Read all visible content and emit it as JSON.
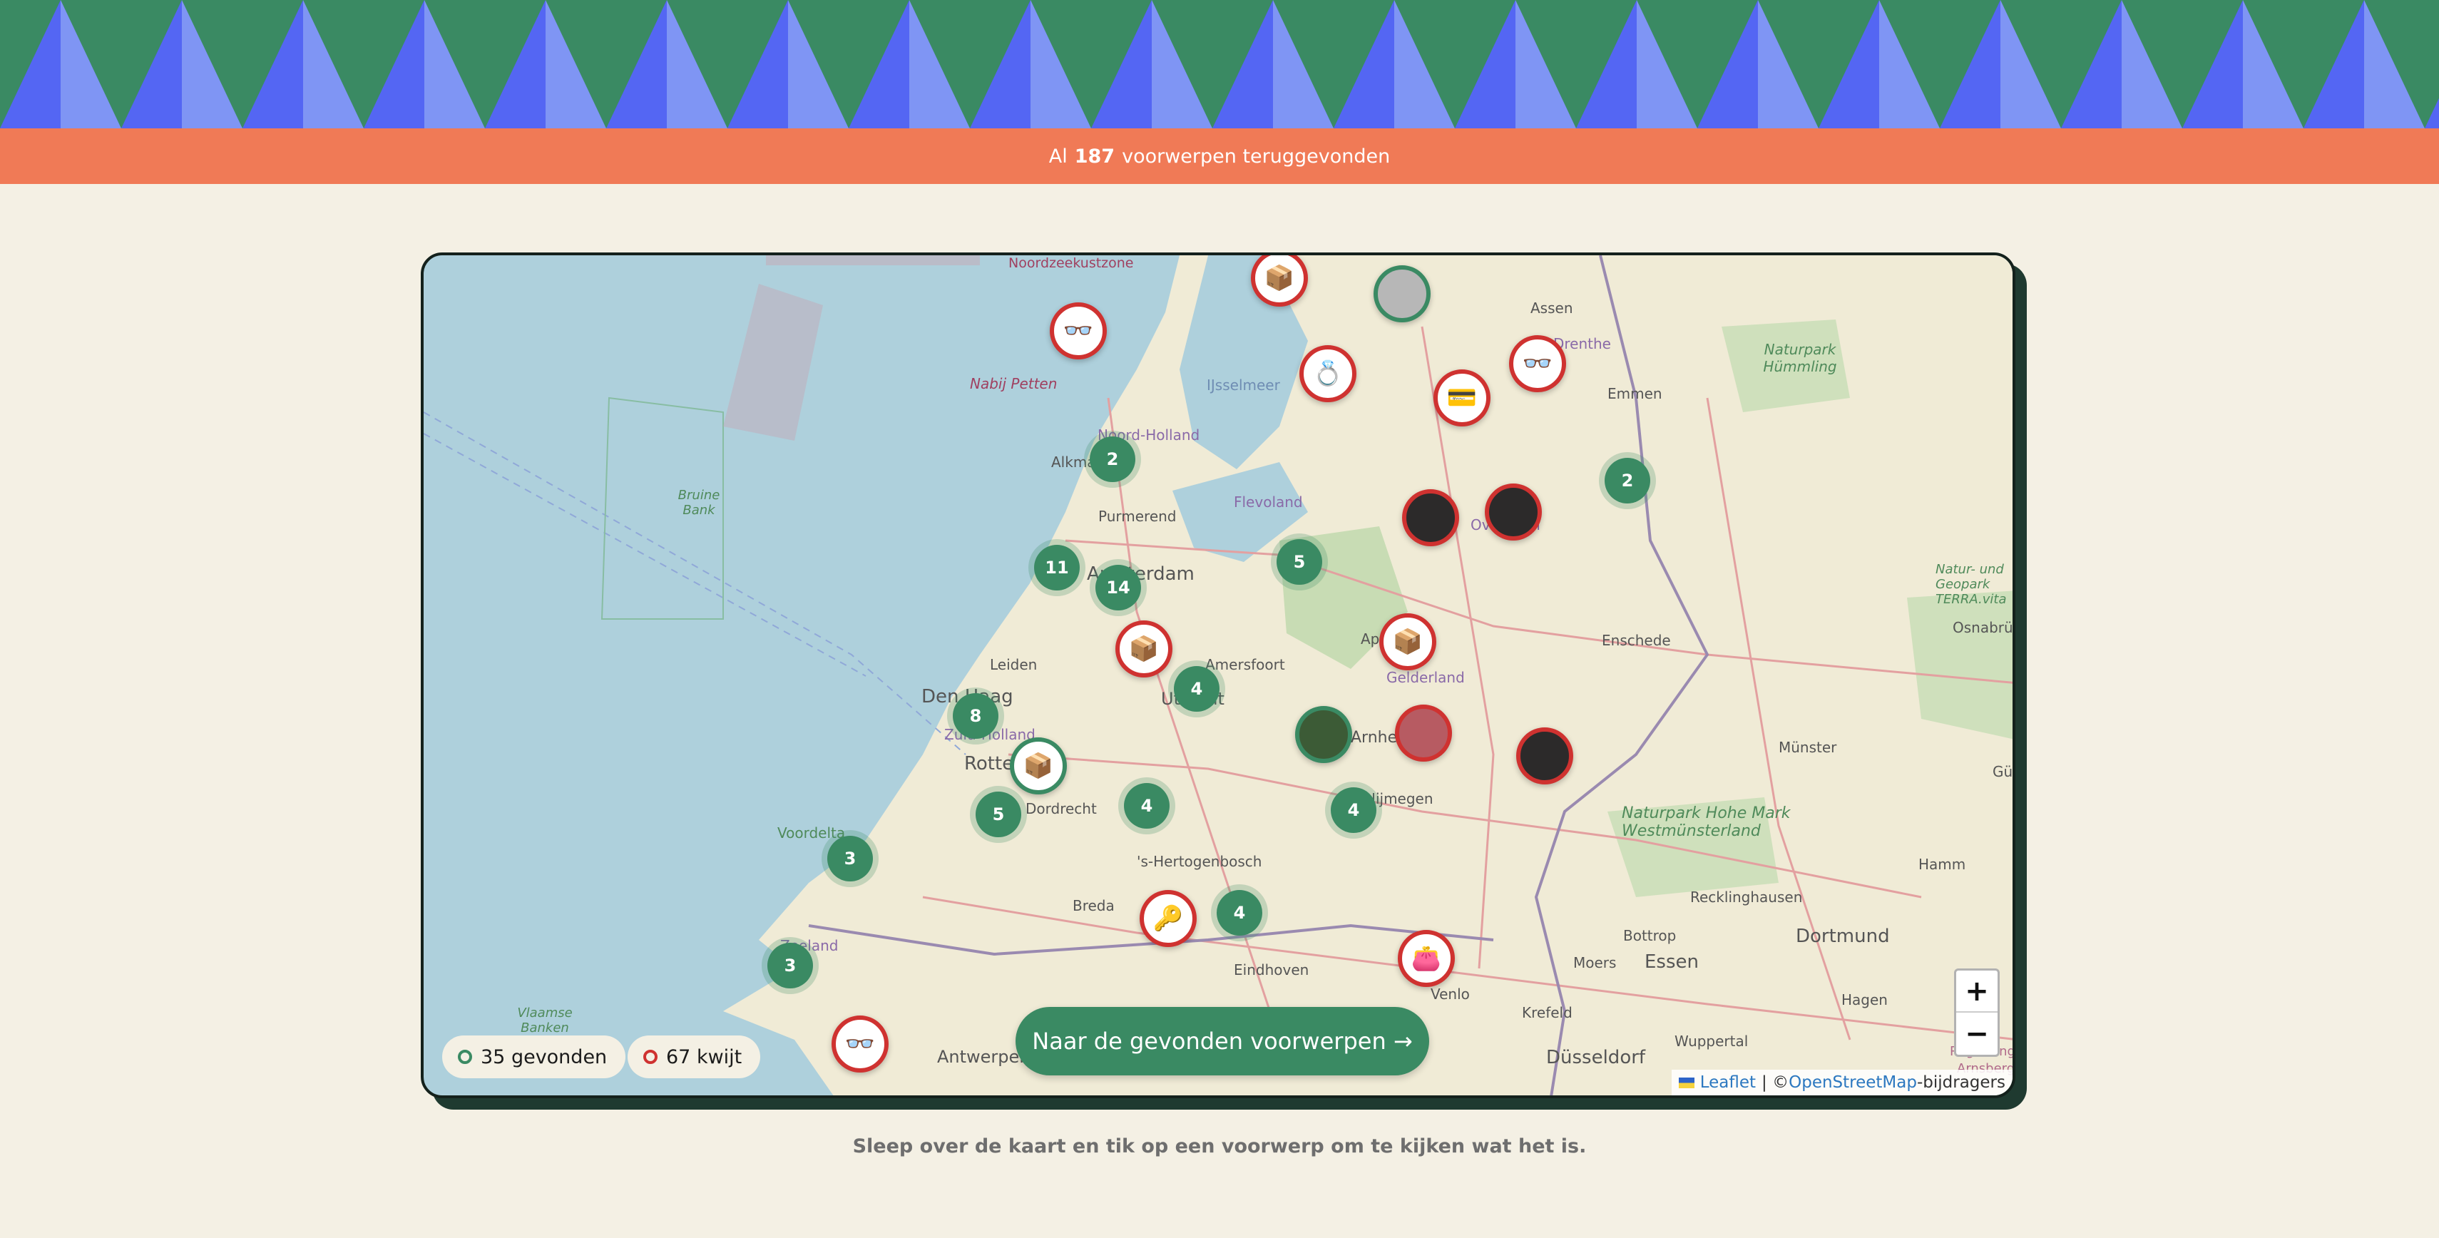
{
  "banner": {
    "colors": {
      "dark_blue": "#5466f3",
      "light_blue": "#7f95f4",
      "green": "#3a8a63"
    }
  },
  "counter": {
    "prefix": "Al",
    "count": "187",
    "suffix": "voorwerpen teruggevonden",
    "background": "#f07a56"
  },
  "map": {
    "labels": {
      "nabij_petten": "Nabij Petten",
      "ijsselmeer": "IJsselmeer",
      "noord_holland": "Noord-Holland",
      "alkmaar": "Alkmaar",
      "purmerend": "Purmerend",
      "flevoland": "Flevoland",
      "amsterdam": "Amsterdam",
      "leiden": "Leiden",
      "den_haag": "Den Haag",
      "zuid_holland": "Zuid-Holland",
      "rotterdam": "Rotterdam",
      "dordrecht": "Dordrecht",
      "amersfoort": "Amersfoort",
      "utrecht": "Utrecht",
      "apeldoorn": "Apeldoorn",
      "gelderland": "Gelderland",
      "arnhem": "Arnhem",
      "nijmegen": "Nijmegen",
      "hertogenbosch": "'s-Hertogenbosch",
      "breda": "Breda",
      "eindhoven": "Eindhoven",
      "venlo": "Venlo",
      "voordelta": "Voordelta",
      "zeeland": "Zeeland",
      "vlaamse_banken": "Vlaamse Banken",
      "antwerpen": "Antwerpen",
      "assen": "Assen",
      "drenthe": "Drenthe",
      "emmen": "Emmen",
      "overijssel": "Overijssel",
      "enschede": "Enschede",
      "naturpark_humling": "Naturpark Hümmling",
      "naturpark_terra": "Natur- und Geopark TERRA.vita",
      "osnabruck": "Osnabrück",
      "munster": "Münster",
      "naturpark_hohe_mark": "Naturpark Hohe Mark Westmünsterland",
      "hamm": "Hamm",
      "recklinghausen": "Recklinghausen",
      "bottrop": "Bottrop",
      "dortmund": "Dortmund",
      "essen": "Essen",
      "hagen": "Hagen",
      "moers": "Moers",
      "krefeld": "Krefeld",
      "wuppertal": "Wuppertal",
      "dusseldorf": "Düsseldorf",
      "bruine_bank": "Bruine Bank",
      "noordzeekustzone": "Noordzeekustzone",
      "gut": "Güt",
      "arnsberg": "Arnsberg",
      "regierung": "Regierung"
    },
    "clusters": [
      "2",
      "11",
      "14",
      "5",
      "2",
      "4",
      "8",
      "5",
      "4",
      "4",
      "3",
      "4",
      "3"
    ],
    "markers": [
      {
        "icon": "📦",
        "status": "lost"
      },
      {
        "icon": "",
        "status": "found"
      },
      {
        "icon": "👓",
        "status": "lost"
      },
      {
        "icon": "💍",
        "status": "lost"
      },
      {
        "icon": "💳",
        "status": "lost"
      },
      {
        "icon": "👓",
        "status": "lost"
      },
      {
        "icon": "",
        "status": "lost"
      },
      {
        "icon": "",
        "status": "lost"
      },
      {
        "icon": "📦",
        "status": "lost"
      },
      {
        "icon": "📦",
        "status": "lost"
      },
      {
        "icon": "",
        "status": "found"
      },
      {
        "icon": "",
        "status": "lost"
      },
      {
        "icon": "",
        "status": "lost"
      },
      {
        "icon": "📦",
        "status": "found"
      },
      {
        "icon": "🔑",
        "status": "lost"
      },
      {
        "icon": "👛",
        "status": "lost"
      },
      {
        "icon": "👓",
        "status": "lost"
      }
    ]
  },
  "legend": {
    "found": "35 gevonden",
    "lost": "67 kwijt",
    "found_color": "#3a8a63",
    "lost_color": "#cf3230"
  },
  "cta": {
    "label": "Naar de gevonden voorwerpen →"
  },
  "zoom": {
    "in": "+",
    "out": "−"
  },
  "attribution": {
    "leaflet": "Leaflet",
    "separator": "| ©",
    "osm": "OpenStreetMap",
    "suffix": "-bijdragers"
  },
  "hint": "Sleep over de kaart en tik op een voorwerp om te kijken wat het is."
}
